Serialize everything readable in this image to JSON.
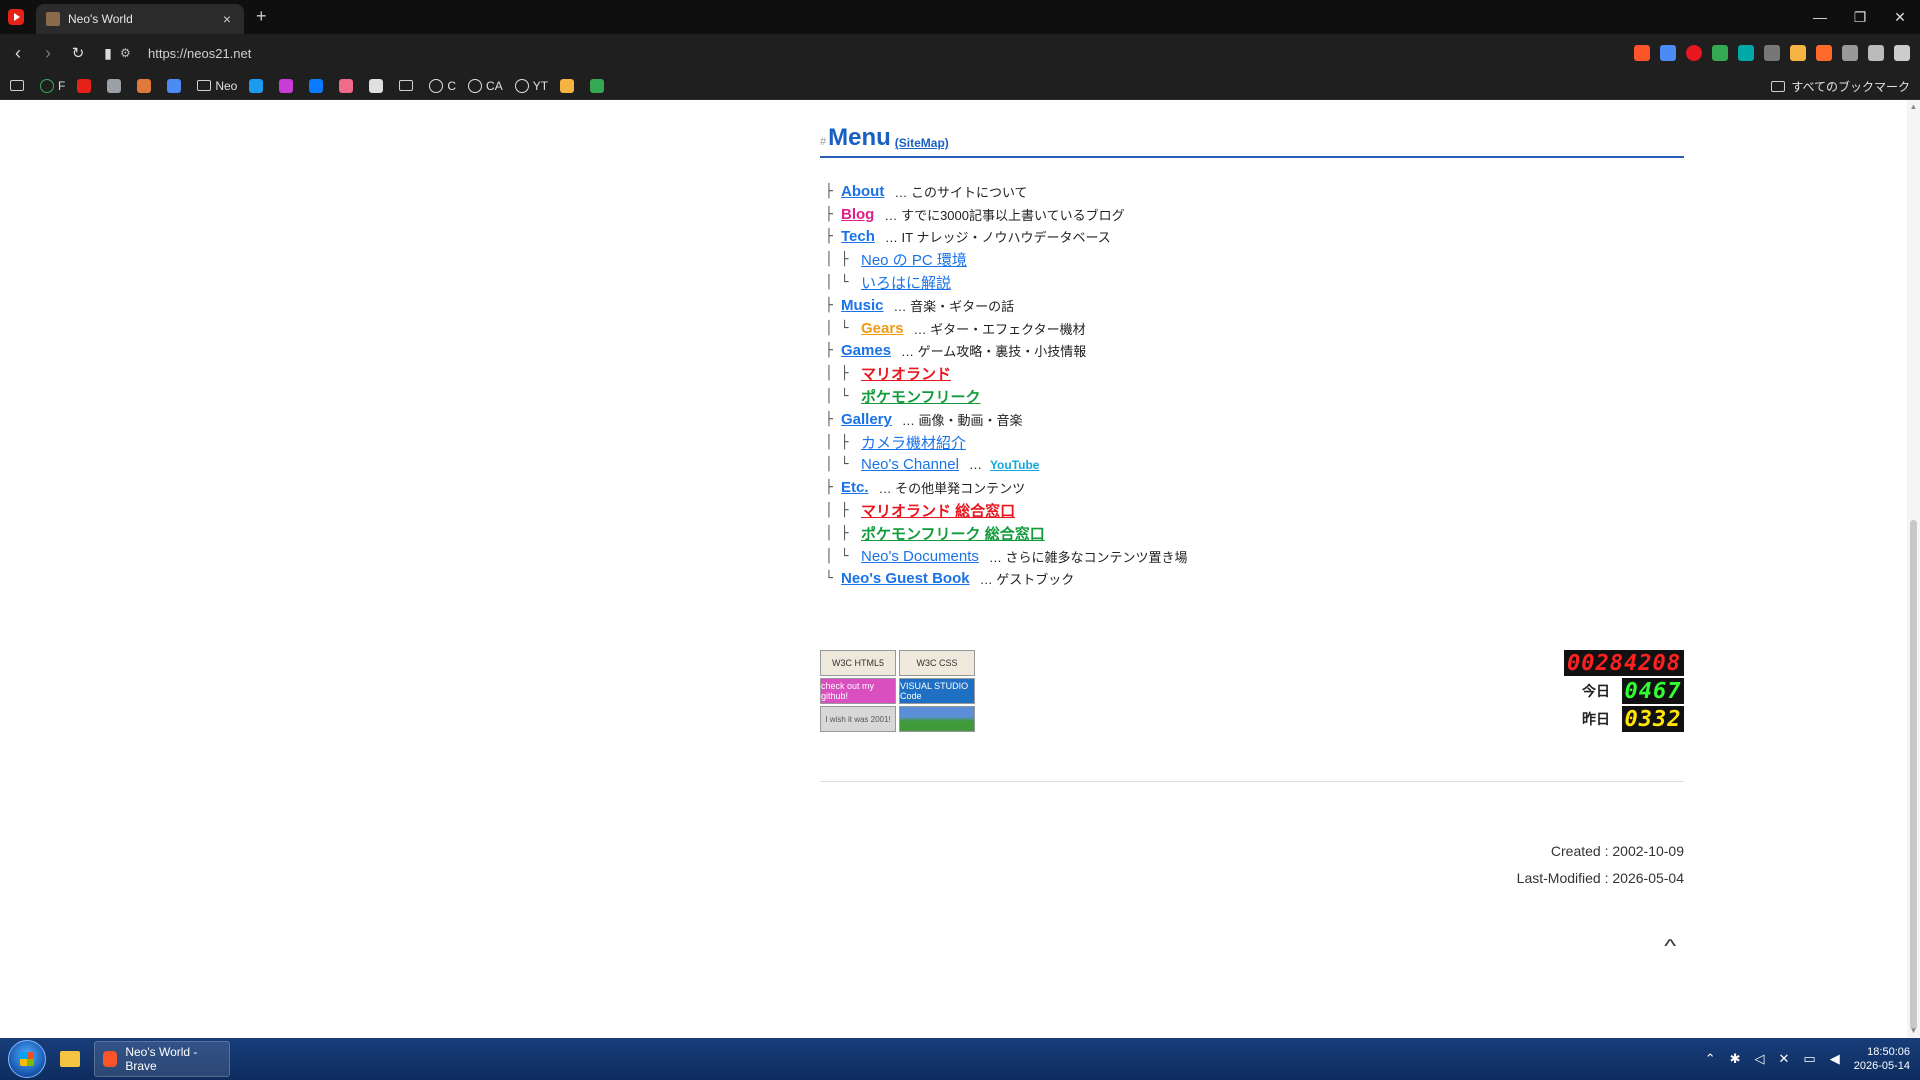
{
  "browser": {
    "tab_title": "Neo's World",
    "tab_close": "×",
    "new_tab": "+",
    "url": "https://neos21.net",
    "bookmarks": [
      {
        "label": "",
        "color": "#cfcfcf",
        "type": "folder"
      },
      {
        "label": "F",
        "color": "#3aa757",
        "type": "globe"
      },
      {
        "label": "",
        "color": "#e62117",
        "type": "icon"
      },
      {
        "label": "",
        "color": "#9aa0a6",
        "type": "icon"
      },
      {
        "label": "",
        "color": "#e07a3c",
        "type": "icon"
      },
      {
        "label": "",
        "color": "#4c8bf5",
        "type": "icon"
      },
      {
        "label": "Neo",
        "color": "#cfcfcf",
        "type": "folder"
      },
      {
        "label": "",
        "color": "#1d9bf0",
        "type": "icon"
      },
      {
        "label": "",
        "color": "#c83cd7",
        "type": "icon"
      },
      {
        "label": "",
        "color": "#0a7aff",
        "type": "icon"
      },
      {
        "label": "",
        "color": "#f06b8b",
        "type": "icon"
      },
      {
        "label": "",
        "color": "#e0e0e0",
        "type": "icon"
      },
      {
        "label": "",
        "color": "#cfcfcf",
        "type": "folder"
      },
      {
        "label": "C",
        "color": "#e0e0e0",
        "type": "globe"
      },
      {
        "label": "CA",
        "color": "#e0e0e0",
        "type": "globe"
      },
      {
        "label": "YT",
        "color": "#e0e0e0",
        "type": "globe"
      },
      {
        "label": "",
        "color": "#f5b342",
        "type": "icon"
      },
      {
        "label": "",
        "color": "#34a853",
        "type": "icon"
      }
    ],
    "all_bookmarks": "すべてのブックマーク"
  },
  "menu": {
    "hash": "#",
    "title": "Menu",
    "sitemap": "(SiteMap)",
    "items": [
      {
        "branch": "├",
        "label": "About",
        "color": "blue",
        "desc": "… このサイトについて"
      },
      {
        "branch": "├",
        "label": "Blog",
        "color": "pink",
        "desc": "… すでに3000記事以上書いているブログ"
      },
      {
        "branch": "├",
        "label": "Tech",
        "color": "blue",
        "desc": "… IT ナレッジ・ノウハウデータベース"
      },
      {
        "branch": "│ ├",
        "label": "Neo の PC 環境",
        "color": "blue",
        "desc": "",
        "normal": true
      },
      {
        "branch": "│ └",
        "label": "いろはに解説",
        "color": "blue",
        "desc": "",
        "normal": true
      },
      {
        "branch": "├",
        "label": "Music",
        "color": "blue",
        "desc": "… 音楽・ギターの話"
      },
      {
        "branch": "│ └",
        "label": "Gears",
        "color": "orange",
        "desc": "… ギター・エフェクター機材"
      },
      {
        "branch": "├",
        "label": "Games",
        "color": "blue",
        "desc": "… ゲーム攻略・裏技・小技情報"
      },
      {
        "branch": "│ ├",
        "label": "マリオランド",
        "color": "red",
        "desc": ""
      },
      {
        "branch": "│ └",
        "label": "ポケモンフリーク",
        "color": "green",
        "desc": ""
      },
      {
        "branch": "├",
        "label": "Gallery",
        "color": "blue",
        "desc": "… 画像・動画・音楽"
      },
      {
        "branch": "│ ├",
        "label": "カメラ機材紹介",
        "color": "blue",
        "desc": "",
        "normal": true
      },
      {
        "branch": "│ └",
        "label": "Neo's Channel",
        "color": "blue",
        "desc": "…",
        "normal": true,
        "extra": "YouTube"
      },
      {
        "branch": "├",
        "label": "Etc.",
        "color": "blue",
        "desc": "… その他単発コンテンツ"
      },
      {
        "branch": "│ ├",
        "label": "マリオランド 総合窓口",
        "color": "red",
        "desc": ""
      },
      {
        "branch": "│ ├",
        "label": "ポケモンフリーク 総合窓口",
        "color": "green",
        "desc": ""
      },
      {
        "branch": "│ └",
        "label": "Neo's Documents",
        "color": "blue",
        "desc": "… さらに雑多なコンテンツ置き場",
        "normal": true
      },
      {
        "branch": "└",
        "label": "Neo's Guest Book",
        "color": "blue",
        "desc": "… ゲストブック"
      }
    ]
  },
  "badges": {
    "html5": "W3C HTML5",
    "css": "W3C CSS",
    "github": "check out my github!",
    "vscode": "VISUAL STUDIO Code",
    "wish": "I wish it was 2001!"
  },
  "counter": {
    "total": "00284208",
    "today_label": "今日",
    "today": "0467",
    "yesterday_label": "昨日",
    "yesterday": "0332"
  },
  "footer": {
    "created": "Created : 2002-10-09",
    "modified": "Last-Modified : 2026-05-04",
    "to_top": "^"
  },
  "taskbar": {
    "app_label": "Neo's World - Brave",
    "time": "18:50:06",
    "date": "2026-05-14"
  }
}
